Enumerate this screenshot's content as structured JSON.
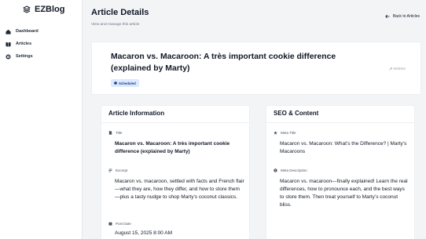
{
  "sidebar": {
    "brand": "EZBlog",
    "items": [
      {
        "label": "Dashboard",
        "icon": "home-icon"
      },
      {
        "label": "Articles",
        "icon": "book-icon"
      },
      {
        "label": "Settings",
        "icon": "gear-icon"
      }
    ]
  },
  "header": {
    "title": "Article Details",
    "subtitle": "View and manage this article",
    "back_label": "Back to Articles"
  },
  "article": {
    "title": "Macaron vs. Macaroon: A très important cookie difference (explained by Marty)",
    "status": "Scheduled",
    "website_label": "Website"
  },
  "info_card": {
    "heading": "Article Information",
    "title_label": "Title",
    "title_value": "Macaron vs. Macaroon: A très important cookie difference (explained by Marty)",
    "excerpt_label": "Excerpt",
    "excerpt_value": "Macaron vs. macaroon, settled with facts and French flair—what they are, how they differ, and how to store them—plus a tasty nudge to shop Marty’s coconut classics.",
    "post_date_label": "Post Date",
    "post_date_value": "August 15, 2025 8:00 AM"
  },
  "seo_card": {
    "heading": "SEO & Content",
    "meta_title_label": "Meta Title",
    "meta_title_value": "Macaron vs. Macaroon: What’s the Difference? | Marty’s Macaroons",
    "meta_description_label": "Meta Description",
    "meta_description_value": "Macaron vs. macaroon—finally explained! Learn the real differences, how to pronounce each, and the best ways to store them. Then treat yourself to Marty’s coconut bliss."
  },
  "colors": {
    "badge_bg": "#dbeafe",
    "badge_text": "#1e3a8a",
    "page_bg": "#f3f4f6"
  }
}
